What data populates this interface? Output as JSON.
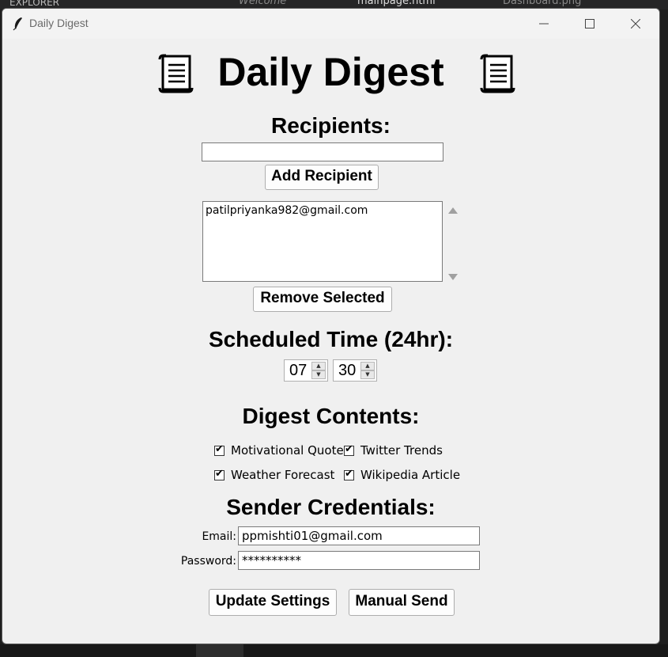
{
  "window": {
    "title": "Daily Digest"
  },
  "background": {
    "explorer_label": "EXPLORER",
    "welcome_tab": "Welcome",
    "mainpage_tab": "mainpage.html",
    "dashboard_tab": "Dashboard.png"
  },
  "app": {
    "title": "Daily Digest",
    "recipients_heading": "Recipients:",
    "recipient_input_value": "",
    "add_recipient_label": "Add Recipient",
    "recipients": [
      "patilpriyanka982@gmail.com"
    ],
    "remove_selected_label": "Remove Selected",
    "schedule_heading": "Scheduled Time (24hr):",
    "hour": "07",
    "minute": "30",
    "contents_heading": "Digest Contents:",
    "contents_options": [
      {
        "label": "Motivational Quote",
        "checked": true
      },
      {
        "label": "Twitter Trends",
        "checked": true
      },
      {
        "label": "Weather Forecast",
        "checked": true
      },
      {
        "label": "Wikipedia Article",
        "checked": true
      }
    ],
    "credentials_heading": "Sender Credentials:",
    "email_label": "Email:",
    "email_value": "ppmishti01@gmail.com",
    "password_label": "Password:",
    "password_value": "**********",
    "update_settings_label": "Update Settings",
    "manual_send_label": "Manual Send"
  },
  "colors": {
    "window_bg": "#f0f0f0",
    "editor_bg": "#1e1e1e"
  }
}
